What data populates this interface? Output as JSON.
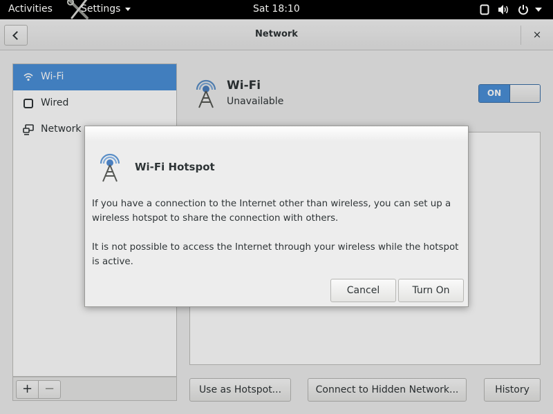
{
  "topbar": {
    "activities": "Activities",
    "app_menu": "Settings",
    "clock": "Sat 18:10",
    "tray_icons": [
      "screen-icon",
      "volume-icon",
      "power-icon",
      "chevron-down-icon"
    ]
  },
  "window": {
    "title": "Network",
    "close": "×"
  },
  "sidebar": {
    "items": [
      {
        "label": "Wi-Fi",
        "icon": "wifi-icon",
        "selected": true
      },
      {
        "label": "Wired",
        "icon": "wired-icon",
        "selected": false
      },
      {
        "label": "Network p",
        "icon": "network-proxy-icon",
        "selected": false
      }
    ],
    "add": "+",
    "remove": "−"
  },
  "main": {
    "wifi_title": "Wi-Fi",
    "wifi_status": "Unavailable",
    "switch_label": "ON",
    "switch_on": true,
    "buttons": {
      "hotspot": "Use as Hotspot...",
      "hidden": "Connect to Hidden Network...",
      "history": "History"
    }
  },
  "dialog": {
    "title": "Wi-Fi Hotspot",
    "p1": "If you have a connection to the Internet other than wireless, you can set up a wireless hotspot to share the connection with others.",
    "p2": "It is not possible to access the Internet through your wireless while the hotspot is active.",
    "cancel": "Cancel",
    "turn_on": "Turn On"
  },
  "colors": {
    "accent": "#4a90d9",
    "topbar_bg": "#000000",
    "window_bg": "#ededed"
  }
}
